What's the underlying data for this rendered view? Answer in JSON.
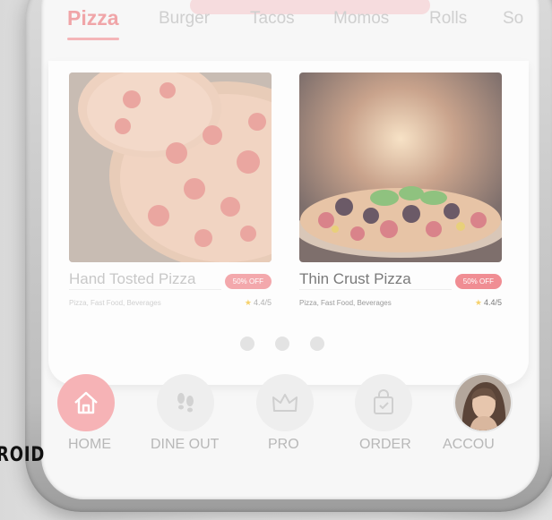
{
  "side_label": "ROID",
  "tabs": [
    {
      "label": "Pizza",
      "active": true
    },
    {
      "label": "Burger",
      "active": false
    },
    {
      "label": "Tacos",
      "active": false
    },
    {
      "label": "Momos",
      "active": false
    },
    {
      "label": "Rolls",
      "active": false
    },
    {
      "label": "So",
      "active": false
    }
  ],
  "cards": [
    {
      "title": "Hand Tosted Pizza",
      "badge": "50% OFF",
      "tags": "Pizza, Fast Food, Beverages",
      "rating": "4.4/5"
    },
    {
      "title": "Thin Crust Pizza",
      "badge": "50% OFF",
      "tags": "Pizza, Fast Food, Beverages",
      "rating": "4.4/5"
    }
  ],
  "nav": [
    {
      "label": "HOME",
      "icon": "home-icon",
      "active": true
    },
    {
      "label": "DINE OUT",
      "icon": "footprints-icon",
      "active": false
    },
    {
      "label": "PRO",
      "icon": "crown-icon",
      "active": false
    },
    {
      "label": "ORDER",
      "icon": "shopping-bag-icon",
      "active": false
    },
    {
      "label": "ACCOU",
      "icon": "avatar",
      "active": false
    }
  ],
  "colors": {
    "accent": "#f08d93",
    "muted_text": "#c8c8c8"
  }
}
